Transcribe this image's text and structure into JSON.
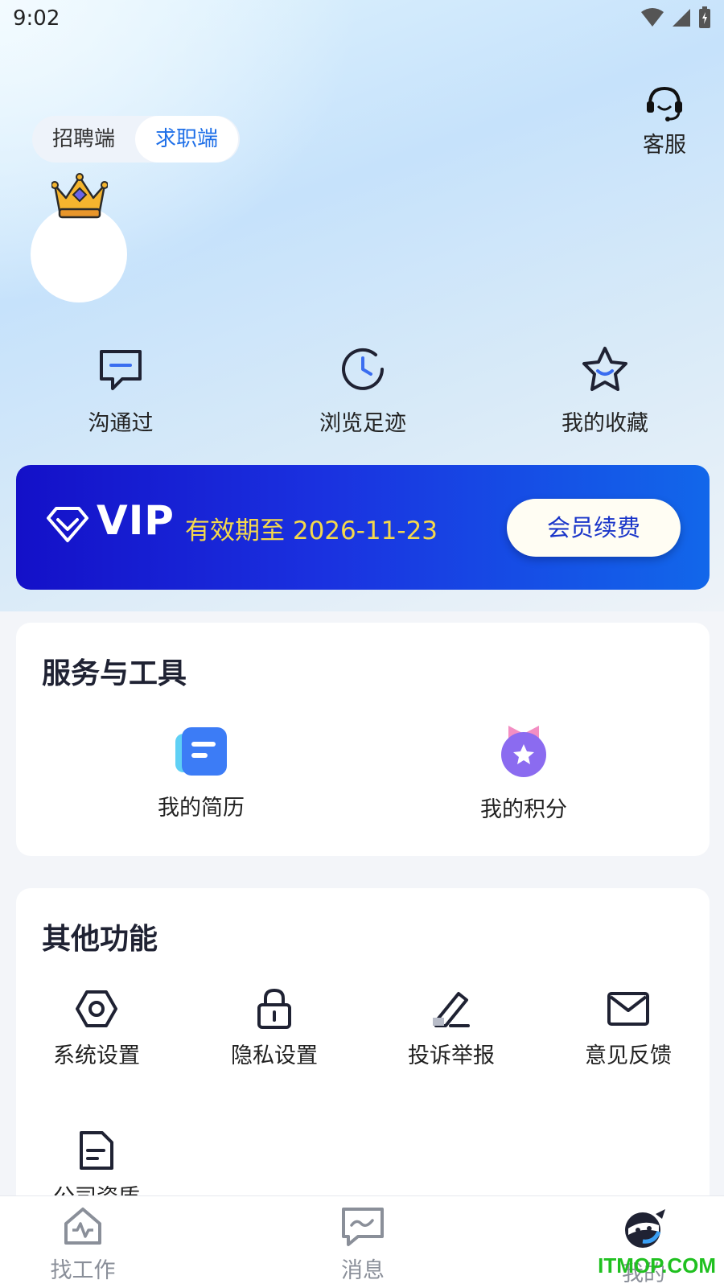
{
  "status_bar": {
    "time": "9:02"
  },
  "header": {
    "role_toggle": {
      "options": [
        "招聘端",
        "求职端"
      ],
      "selected": "求职端"
    },
    "customer_service_label": "客服"
  },
  "quick_actions": [
    {
      "label": "沟通过",
      "icon": "chat-icon"
    },
    {
      "label": "浏览足迹",
      "icon": "history-icon"
    },
    {
      "label": "我的收藏",
      "icon": "star-icon"
    }
  ],
  "vip": {
    "title": "VIP",
    "expire_text": "有效期至 2026-11-23",
    "renew_button": "会员续费",
    "accent_color": "#f5d94b"
  },
  "services": {
    "title": "服务与工具",
    "items": [
      {
        "label": "我的简历",
        "icon": "resume-icon"
      },
      {
        "label": "我的积分",
        "icon": "points-icon"
      }
    ]
  },
  "other": {
    "title": "其他功能",
    "items": [
      {
        "label": "系统设置",
        "icon": "settings-icon"
      },
      {
        "label": "隐私设置",
        "icon": "lock-icon"
      },
      {
        "label": "投诉举报",
        "icon": "edit-icon"
      },
      {
        "label": "意见反馈",
        "icon": "mail-icon"
      },
      {
        "label": "公司资质",
        "icon": "document-icon"
      }
    ]
  },
  "tabbar": {
    "tabs": [
      {
        "label": "找工作",
        "icon": "job-icon"
      },
      {
        "label": "消息",
        "icon": "message-icon"
      },
      {
        "label": "我的",
        "icon": "profile-icon",
        "active": true
      }
    ]
  },
  "watermark": "ITMOP.COM",
  "colors": {
    "brand_blue": "#1e6fe8",
    "vip_gradient_start": "#1410c8",
    "vip_gradient_end": "#1267ea"
  }
}
